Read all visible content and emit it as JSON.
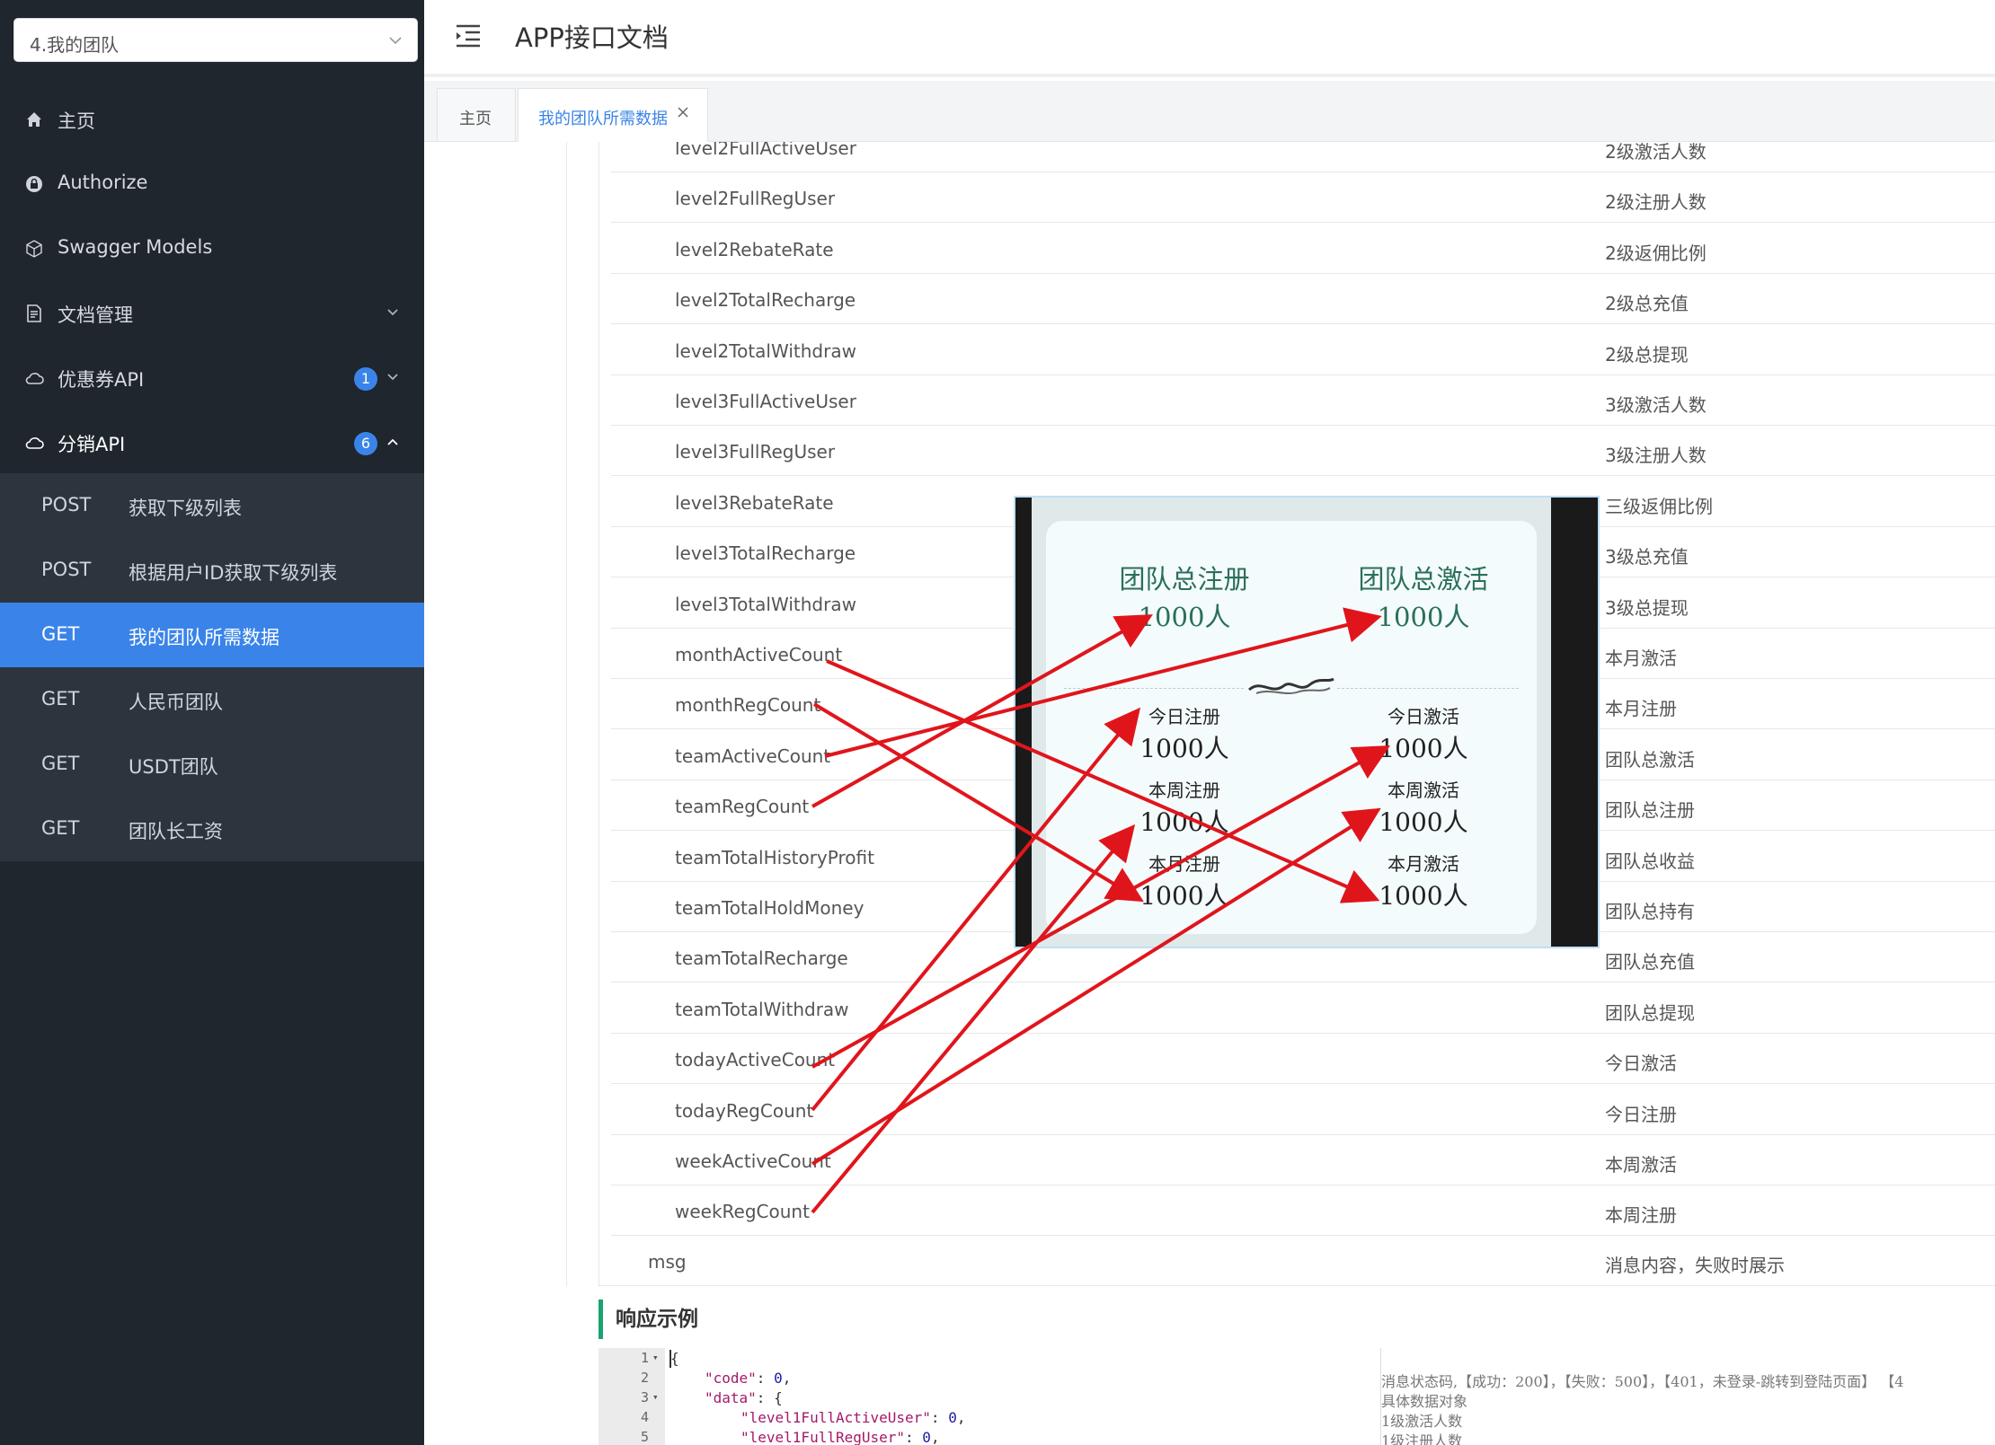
{
  "sidebar": {
    "selector_value": "4.我的团队",
    "menu": [
      {
        "label": "主页",
        "icon": "home-icon"
      },
      {
        "label": "Authorize",
        "icon": "lock-icon"
      },
      {
        "label": "Swagger Models",
        "icon": "cube-icon"
      },
      {
        "label": "文档管理",
        "icon": "document-icon"
      },
      {
        "label": "优惠券API",
        "icon": "cloud-icon",
        "badge": "1"
      },
      {
        "label": "分销API",
        "icon": "cloud-icon",
        "badge": "6"
      }
    ],
    "submenu": [
      {
        "method": "POST",
        "label": "获取下级列表"
      },
      {
        "method": "POST",
        "label": "根据用户ID获取下级列表"
      },
      {
        "method": "GET",
        "label": "我的团队所需数据",
        "active": true
      },
      {
        "method": "GET",
        "label": "人民币团队"
      },
      {
        "method": "GET",
        "label": "USDT团队"
      },
      {
        "method": "GET",
        "label": "团队长工资"
      }
    ]
  },
  "header": {
    "title": "APP接口文档"
  },
  "tabs": [
    {
      "label": "主页"
    },
    {
      "label": "我的团队所需数据",
      "active": true
    }
  ],
  "rows": [
    {
      "name": "level2FullActiveUser",
      "desc": "2级激活人数"
    },
    {
      "name": "level2FullRegUser",
      "desc": "2级注册人数"
    },
    {
      "name": "level2RebateRate",
      "desc": "2级返佣比例"
    },
    {
      "name": "level2TotalRecharge",
      "desc": "2级总充值"
    },
    {
      "name": "level2TotalWithdraw",
      "desc": "2级总提现"
    },
    {
      "name": "level3FullActiveUser",
      "desc": "3级激活人数"
    },
    {
      "name": "level3FullRegUser",
      "desc": "3级注册人数"
    },
    {
      "name": "level3RebateRate",
      "desc": "三级返佣比例"
    },
    {
      "name": "level3TotalRecharge",
      "desc": "3级总充值"
    },
    {
      "name": "level3TotalWithdraw",
      "desc": "3级总提现"
    },
    {
      "name": "monthActiveCount",
      "desc": "本月激活"
    },
    {
      "name": "monthRegCount",
      "desc": "本月注册"
    },
    {
      "name": "teamActiveCount",
      "desc": "团队总激活"
    },
    {
      "name": "teamRegCount",
      "desc": "团队总注册"
    },
    {
      "name": "teamTotalHistoryProfit",
      "desc": "团队总收益"
    },
    {
      "name": "teamTotalHoldMoney",
      "desc": "团队总持有"
    },
    {
      "name": "teamTotalRecharge",
      "desc": "团队总充值"
    },
    {
      "name": "teamTotalWithdraw",
      "desc": "团队总提现"
    },
    {
      "name": "todayActiveCount",
      "desc": "今日激活"
    },
    {
      "name": "todayRegCount",
      "desc": "今日注册"
    },
    {
      "name": "weekActiveCount",
      "desc": "本周激活"
    },
    {
      "name": "weekRegCount",
      "desc": "本周注册"
    }
  ],
  "msg_row": {
    "name": "msg",
    "desc": "消息内容，失败时展示"
  },
  "response_example": {
    "title": "响应示例",
    "line_numbers": [
      "1",
      "2",
      "3",
      "4",
      "5"
    ],
    "code": {
      "l1": "{",
      "code_key": "\"code\"",
      "code_val": "0",
      "data_key": "\"data\"",
      "l4_key": "\"level1FullActiveUser\"",
      "l4_val": "0",
      "l5_key": "\"level1FullRegUser\"",
      "l5_val": "0"
    },
    "comments": [
      "消息状态码,【成功：200】，【失败：500】，【401，未登录-跳转到登陆页面】 【4",
      "具体数据对象",
      "1级激活人数",
      "1级注册人数"
    ]
  },
  "mockup": {
    "reg_total_label": "团队总注册",
    "reg_total_value": "1000人",
    "act_total_label": "团队总激活",
    "act_total_value": "1000人",
    "today_reg_label": "今日注册",
    "today_reg_value": "1000人",
    "today_act_label": "今日激活",
    "today_act_value": "1000人",
    "week_reg_label": "本周注册",
    "week_reg_value": "1000人",
    "week_act_label": "本周激活",
    "week_act_value": "1000人",
    "month_reg_label": "本月注册",
    "month_reg_value": "1000人",
    "month_act_label": "本月激活",
    "month_act_value": "1000人"
  },
  "colors": {
    "sidebar_bg": "#1f262d",
    "active_blue": "#3a84e9",
    "arrow_red": "#e0151c",
    "section_green": "#1aa36f"
  }
}
